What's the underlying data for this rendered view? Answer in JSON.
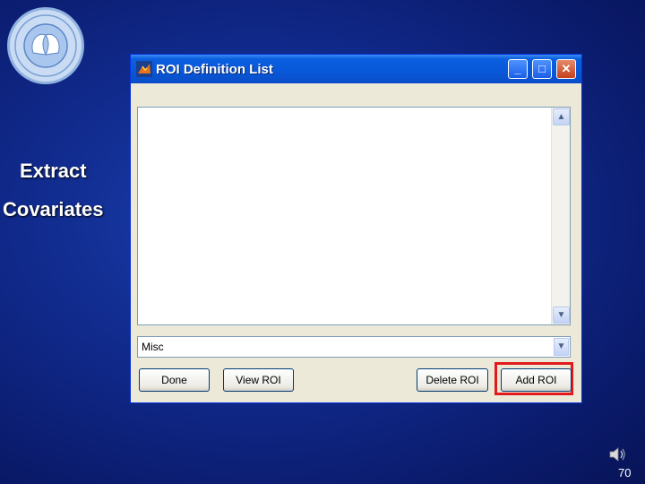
{
  "slide": {
    "heading_line1": "Extract",
    "heading_line2": "Covariates",
    "page_number": "70"
  },
  "window": {
    "title": "ROI Definition List",
    "controls": {
      "minimize": "_",
      "maximize": "□",
      "close": "✕"
    }
  },
  "roi_list": {
    "items": []
  },
  "category_select": {
    "selected": "Misc"
  },
  "buttons": {
    "done": "Done",
    "view_roi": "View ROI",
    "delete_roi": "Delete ROI",
    "add_roi": "Add ROI"
  },
  "colors": {
    "slide_background": "#10298a",
    "titlebar": "#0858d8",
    "highlight": "#e11b1b"
  }
}
